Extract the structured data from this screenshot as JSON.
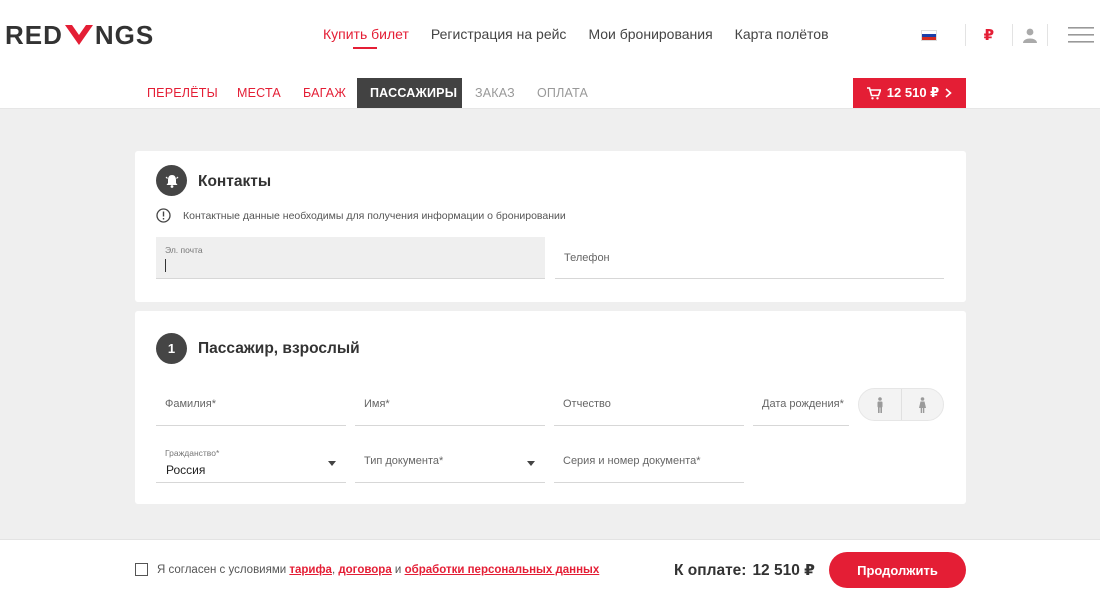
{
  "header": {
    "logo": {
      "left": "RED",
      "right": "NGS"
    },
    "nav": [
      "Купить билет",
      "Регистрация на рейс",
      "Мои бронирования",
      "Карта полётов"
    ],
    "currency": "₽",
    "flag_colors": [
      "#ffffff",
      "#1c3fa8",
      "#d52b1e"
    ],
    "icons": [
      "russia-flag-icon",
      "user-icon",
      "menu-icon"
    ]
  },
  "steps": {
    "items": [
      "ПЕРЕЛЁТЫ",
      "МЕСТА",
      "БАГАЖ",
      "ПАССАЖИРЫ",
      "ЗАКАЗ",
      "ОПЛАТА"
    ],
    "current": "ПАССАЖИРЫ",
    "cart_total": "12 510 ₽"
  },
  "contacts": {
    "title": "Контакты",
    "note": "Контактные данные необходимы для получения информации о бронировании",
    "email_label": "Эл. почта",
    "phone_label": "Телефон"
  },
  "passenger": {
    "number": "1",
    "title": "Пассажир, взрослый",
    "surname_label": "Фамилия*",
    "name_label": "Имя*",
    "patronymic_label": "Отчество",
    "birthdate_label": "Дата рождения*",
    "citizenship_label": "Гражданство*",
    "citizenship_value": "Россия",
    "doc_type_label": "Тип документа*",
    "doc_number_label": "Серия и номер документа*"
  },
  "footer": {
    "agree_prefix": "Я согласен с условиями",
    "link_tariff": "тарифа",
    "comma": ",",
    "link_contract": "договора",
    "and": "и",
    "link_personal": "обработки персональных данных",
    "total_label": "К оплате:",
    "total_amount": "12 510 ₽",
    "continue_label": "Продолжить"
  },
  "colors": {
    "accent": "#e41e35",
    "dark": "#424242",
    "background": "#efefef"
  }
}
